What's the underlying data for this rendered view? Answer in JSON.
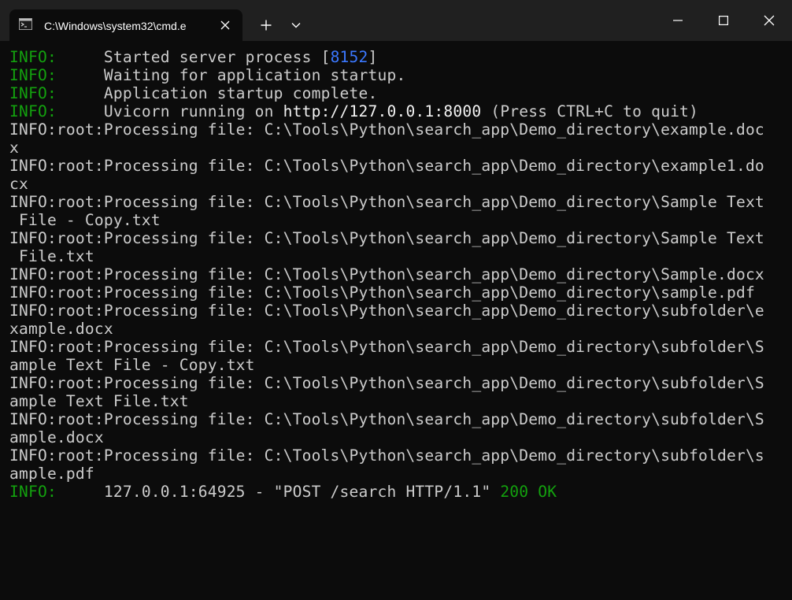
{
  "window": {
    "tab_title": "C:\\Windows\\system32\\cmd.e",
    "icons": {
      "tab": "terminal-icon",
      "tab_close": "close-icon",
      "new_tab": "plus-icon",
      "dropdown": "chevron-down-icon",
      "minimize": "minimize-icon",
      "maximize": "maximize-icon",
      "close": "close-icon"
    }
  },
  "colors": {
    "background": "#0c0c0c",
    "titlebar": "#202020",
    "text": "#cccccc",
    "info_green": "#13a10e",
    "pid_blue": "#3b78ff"
  },
  "terminal": {
    "startup": [
      {
        "level": "INFO:",
        "msg": "Started server process ["
      },
      {
        "level": "INFO:",
        "msg": "Waiting for application startup."
      },
      {
        "level": "INFO:",
        "msg": "Application startup complete."
      },
      {
        "level": "INFO:",
        "msg": "Uvicorn running on "
      }
    ],
    "pid": "8152",
    "pid_close": "]",
    "url": "http://127.0.0.1:8000",
    "url_suffix": " (Press CTRL+C to quit)",
    "processing_lines": [
      "INFO:root:Processing file: C:\\Tools\\Python\\search_app\\Demo_directory\\example.doc",
      "x",
      "INFO:root:Processing file: C:\\Tools\\Python\\search_app\\Demo_directory\\example1.do",
      "cx",
      "INFO:root:Processing file: C:\\Tools\\Python\\search_app\\Demo_directory\\Sample Text",
      " File - Copy.txt",
      "INFO:root:Processing file: C:\\Tools\\Python\\search_app\\Demo_directory\\Sample Text",
      " File.txt",
      "INFO:root:Processing file: C:\\Tools\\Python\\search_app\\Demo_directory\\Sample.docx",
      "INFO:root:Processing file: C:\\Tools\\Python\\search_app\\Demo_directory\\sample.pdf",
      "INFO:root:Processing file: C:\\Tools\\Python\\search_app\\Demo_directory\\subfolder\\e",
      "xample.docx",
      "INFO:root:Processing file: C:\\Tools\\Python\\search_app\\Demo_directory\\subfolder\\S",
      "ample Text File - Copy.txt",
      "INFO:root:Processing file: C:\\Tools\\Python\\search_app\\Demo_directory\\subfolder\\S",
      "ample Text File.txt",
      "INFO:root:Processing file: C:\\Tools\\Python\\search_app\\Demo_directory\\subfolder\\S",
      "ample.docx",
      "INFO:root:Processing file: C:\\Tools\\Python\\search_app\\Demo_directory\\subfolder\\s",
      "ample.pdf"
    ],
    "request": {
      "level": "INFO:",
      "msg": "127.0.0.1:64925 - \"POST /search HTTP/1.1\" ",
      "status": "200 OK"
    }
  }
}
